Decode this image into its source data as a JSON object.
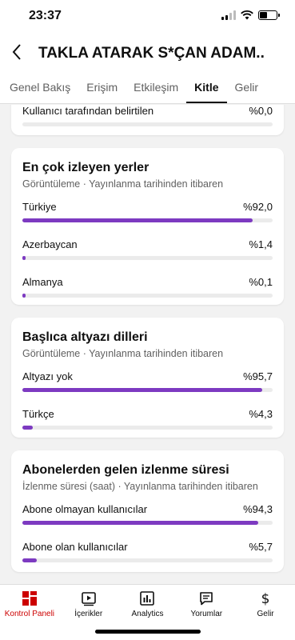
{
  "status": {
    "time": "23:37"
  },
  "header": {
    "title": "TAKLA ATARAK S*ÇAN ADAM..",
    "back_icon": "chevron-left-icon"
  },
  "tabs": [
    {
      "label": "Genel Bakış",
      "active": false
    },
    {
      "label": "Erişim",
      "active": false
    },
    {
      "label": "Etkileşim",
      "active": false
    },
    {
      "label": "Kitle",
      "active": true
    },
    {
      "label": "Gelir",
      "active": false
    }
  ],
  "partial_card": {
    "label": "Kullanıcı tarafından belirtilen",
    "value": "%0,0",
    "fraction": 0.0
  },
  "top_locations": {
    "title": "En çok izleyen yerler",
    "subtitle": "Görüntüleme · Yayınlanma tarihinden itibaren",
    "rows": [
      {
        "label": "Türkiye",
        "value": "%92,0",
        "fraction": 0.92
      },
      {
        "label": "Azerbaycan",
        "value": "%1,4",
        "fraction": 0.014
      },
      {
        "label": "Almanya",
        "value": "%0,1",
        "fraction": 0.001
      }
    ]
  },
  "subtitle_languages": {
    "title": "Başlıca altyazı dilleri",
    "subtitle": "Görüntüleme · Yayınlanma tarihinden itibaren",
    "rows": [
      {
        "label": "Altyazı yok",
        "value": "%95,7",
        "fraction": 0.957
      },
      {
        "label": "Türkçe",
        "value": "%4,3",
        "fraction": 0.043
      }
    ]
  },
  "subscriber_watch": {
    "title": "Abonelerden gelen izlenme süresi",
    "subtitle": "İzlenme süresi (saat) · Yayınlanma tarihinden itibaren",
    "rows": [
      {
        "label": "Abone olmayan kullanıcılar",
        "value": "%94,3",
        "fraction": 0.943
      },
      {
        "label": "Abone olan kullanıcılar",
        "value": "%5,7",
        "fraction": 0.057
      }
    ]
  },
  "nav": [
    {
      "label": "Kontrol Paneli",
      "icon": "dashboard-icon",
      "active": true
    },
    {
      "label": "İçerikler",
      "icon": "video-library-icon",
      "active": false
    },
    {
      "label": "Analytics",
      "icon": "analytics-icon",
      "active": false
    },
    {
      "label": "Yorumlar",
      "icon": "comment-icon",
      "active": false
    },
    {
      "label": "Gelir",
      "icon": "dollar-icon",
      "active": false
    }
  ],
  "colors": {
    "accent": "#7d3ac1",
    "active_nav": "#cc0000"
  }
}
